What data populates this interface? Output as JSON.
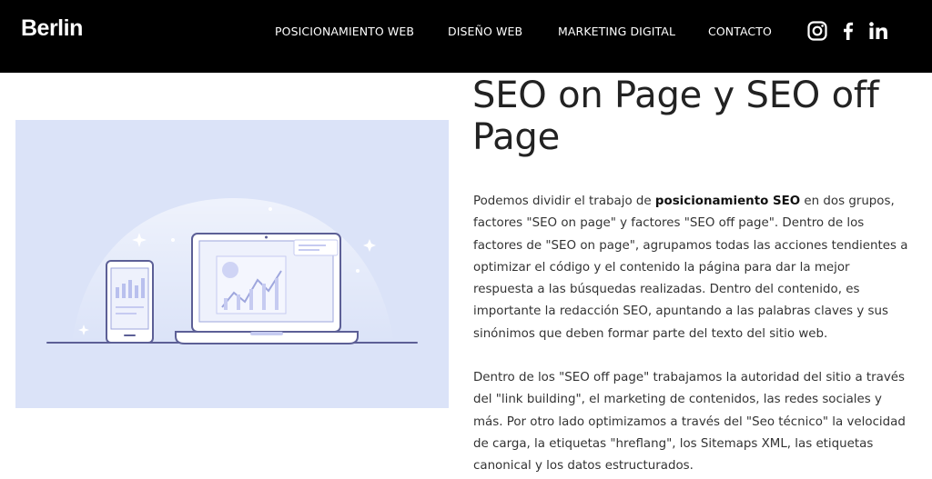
{
  "brand": {
    "logo": "Berlin"
  },
  "nav": {
    "items": [
      {
        "label": "POSICIONAMIENTO WEB"
      },
      {
        "label": "DISEÑO WEB"
      },
      {
        "label": "MARKETING DIGITAL"
      },
      {
        "label": "CONTACTO"
      }
    ],
    "social": [
      "instagram-icon",
      "facebook-icon",
      "linkedin-icon"
    ]
  },
  "article": {
    "title": "SEO on Page y SEO off Page",
    "p1": {
      "before": "Podemos dividir el trabajo de ",
      "bold": "posicionamiento SEO",
      "after": " en dos grupos, factores \"SEO on page\" y factores \"SEO off page\". Dentro de los factores de \"SEO on page\", agrupamos todas las acciones tendientes a optimizar el código y el contenido la página para dar la mejor respuesta a las búsquedas realizadas. Dentro del contenido, es importante la redacción SEO, apuntando a las palabras claves y sus sinónimos que deben formar parte del texto del sitio web."
    },
    "p2": "Dentro de los \"SEO off page\" trabajamos la autoridad del sitio a través del \"link building\", el marketing de contenidos, las redes sociales y más.  Por otro lado optimizamos a través del \"Seo técnico\" la velocidad de carga, la etiquetas \"hreflang\", los Sitemaps XML, las etiquetas canonical y los datos estructurados."
  },
  "colors": {
    "header_bg": "#000000",
    "illustration_bg": "#dbe3f8",
    "illustration_line": "#5c5f96"
  }
}
